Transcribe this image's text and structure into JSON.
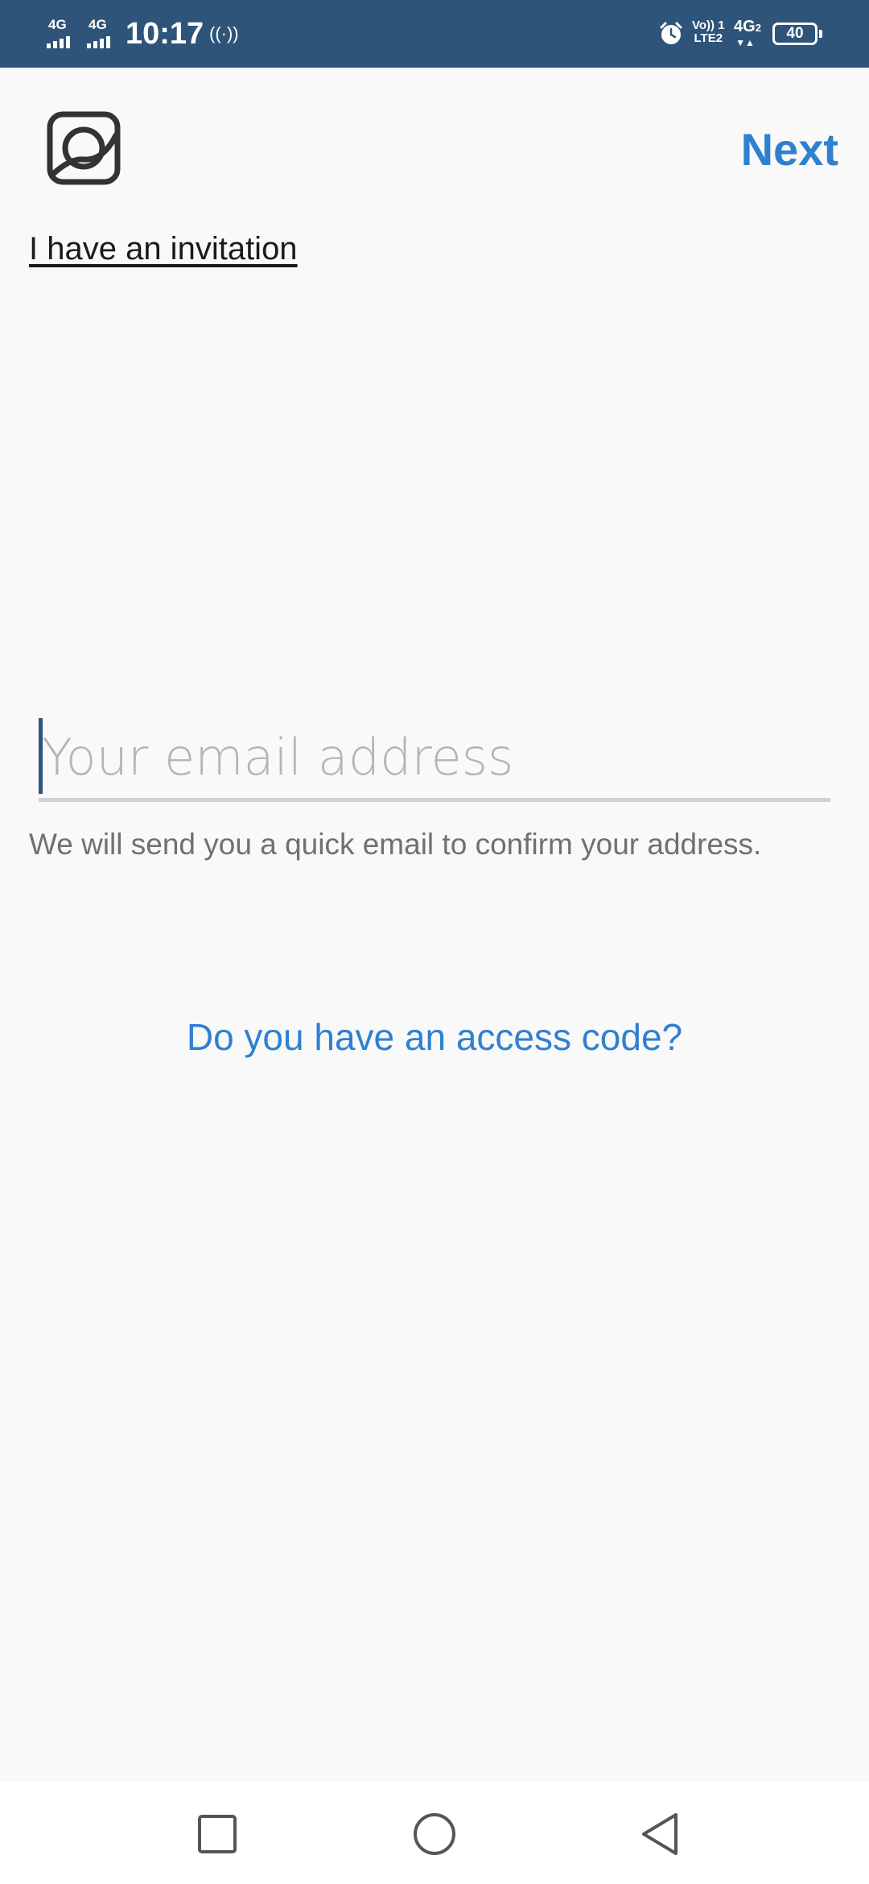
{
  "status_bar": {
    "network_1": "4G",
    "network_2": "4G",
    "time": "10:17",
    "hotspot_glyph": "((·))",
    "volte_top": "Vo)) 1",
    "volte_bottom": "LTE2",
    "network_3": "4G",
    "network_3_arrows": "▼▲",
    "battery_level": "40",
    "icons": [
      "signal-icon",
      "hotspot-icon",
      "alarm-icon",
      "volte-icon",
      "battery-icon"
    ],
    "background_color": "#2f5479"
  },
  "header": {
    "logo_icon": "app-logo-icon",
    "next_label": "Next",
    "invitation_label": "I have an invitation"
  },
  "form": {
    "email_value": "",
    "email_placeholder": "Your email address",
    "helper_text": "We will send you a quick email to confirm your address.",
    "access_code_label": "Do you have an access code?"
  },
  "nav_bar": {
    "icons": [
      "recents-square-icon",
      "home-circle-icon",
      "back-triangle-icon"
    ]
  },
  "colors": {
    "accent": "#2f80d1",
    "background": "#f9f9f9",
    "helper_text": "#707070"
  }
}
